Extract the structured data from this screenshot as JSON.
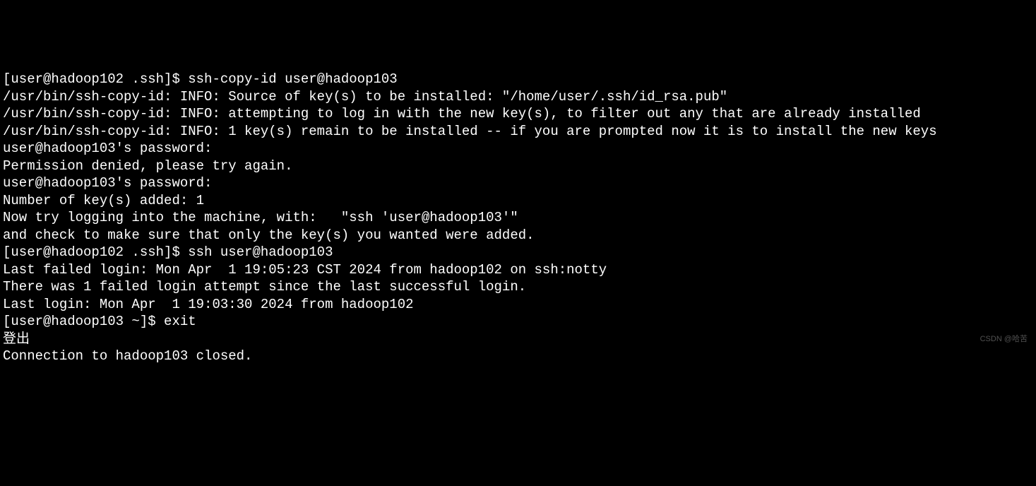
{
  "lines": [
    "[user@hadoop102 .ssh]$ ssh-copy-id user@hadoop103",
    "/usr/bin/ssh-copy-id: INFO: Source of key(s) to be installed: \"/home/user/.ssh/id_rsa.pub\"",
    "/usr/bin/ssh-copy-id: INFO: attempting to log in with the new key(s), to filter out any that are already installed",
    "/usr/bin/ssh-copy-id: INFO: 1 key(s) remain to be installed -- if you are prompted now it is to install the new keys",
    "user@hadoop103's password:",
    "Permission denied, please try again.",
    "user@hadoop103's password:",
    "",
    "Number of key(s) added: 1",
    "",
    "Now try logging into the machine, with:   \"ssh 'user@hadoop103'\"",
    "and check to make sure that only the key(s) you wanted were added.",
    "",
    "[user@hadoop102 .ssh]$ ssh user@hadoop103",
    "Last failed login: Mon Apr  1 19:05:23 CST 2024 from hadoop102 on ssh:notty",
    "There was 1 failed login attempt since the last successful login.",
    "Last login: Mon Apr  1 19:03:30 2024 from hadoop102",
    "[user@hadoop103 ~]$ exit",
    "登出",
    "Connection to hadoop103 closed."
  ],
  "watermark": "CSDN @哈苦"
}
